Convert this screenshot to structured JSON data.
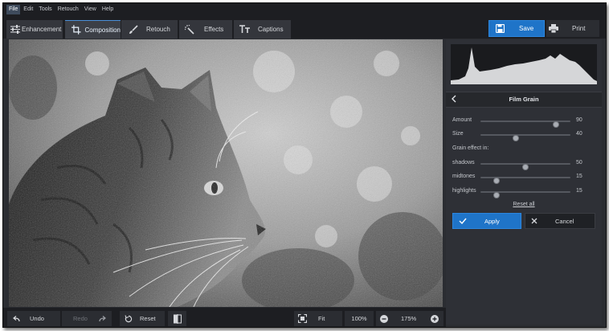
{
  "menu": [
    "File",
    "Edit",
    "Tools",
    "Retouch",
    "View",
    "Help"
  ],
  "tabs": [
    {
      "label": "Enhancement",
      "icon": "sliders-icon"
    },
    {
      "label": "Composition",
      "icon": "crop-icon"
    },
    {
      "label": "Retouch",
      "icon": "brush-icon"
    },
    {
      "label": "Effects",
      "icon": "magic-wand-icon"
    },
    {
      "label": "Captions",
      "icon": "text-icon"
    }
  ],
  "actions": {
    "save": "Save",
    "print": "Print"
  },
  "panel": {
    "title": "Film Grain",
    "params": [
      {
        "label": "Amount",
        "value": 90
      },
      {
        "label": "Size",
        "value": 40
      }
    ],
    "section": "Grain effect in:",
    "ranges": [
      {
        "label": "shadows",
        "value": 50
      },
      {
        "label": "midtones",
        "value": 15
      },
      {
        "label": "highlights",
        "value": 15
      }
    ],
    "reset_all": "Reset all",
    "apply": "Apply",
    "cancel": "Cancel"
  },
  "bottom": {
    "undo": "Undo",
    "redo": "Redo",
    "reset": "Reset",
    "fit": "Fit",
    "zoom_100": "100%",
    "zoom_current": "175%"
  },
  "colors": {
    "accent": "#1f74c8",
    "background": "#2b2d32",
    "bar": "#1d1e22"
  }
}
